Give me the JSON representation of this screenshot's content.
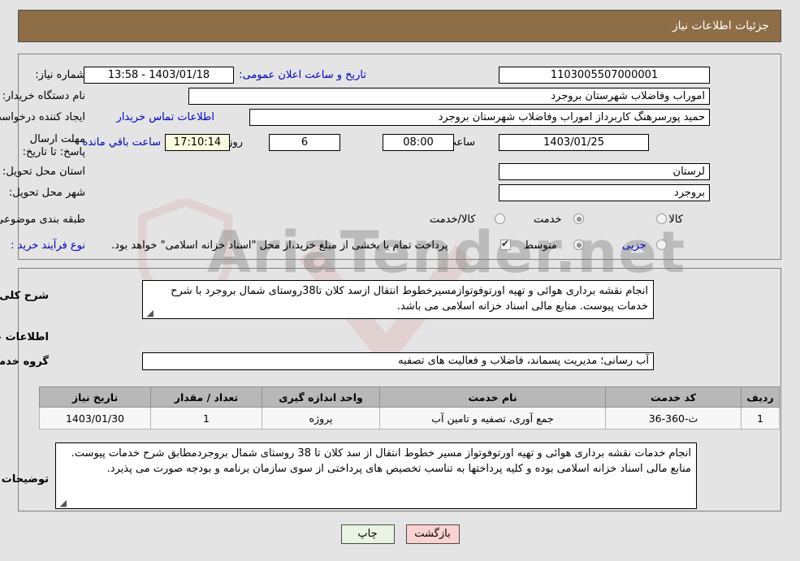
{
  "header": {
    "title": "جزئیات اطلاعات نیاز"
  },
  "form": {
    "need_number_label": "شماره نیاز:",
    "need_number_value": "1103005507000001",
    "announce_datetime_label": "تاریخ و ساعت اعلان عمومی:",
    "announce_datetime_value": "1403/01/18 - 13:58",
    "buyer_org_label": "نام دستگاه خریدار:",
    "buyer_org_value": "اموراب وفاضلاب شهرستان بروجرد",
    "requester_label": "ایجاد کننده درخواست:",
    "requester_value": "حمید پورسرهنگ کاربرداز اموراب وفاضلاب شهرستان بروجرد",
    "buyer_contact_link": "اطلاعات تماس خریدار",
    "deadline_label": "مهلت ارسال پاسخ: تا تاریخ:",
    "deadline_date": "1403/01/25",
    "deadline_time_label": "ساعت",
    "deadline_time": "08:00",
    "remaining_days": "6",
    "remaining_days_unit": "روز و",
    "remaining_clock": "17:10:14",
    "remaining_suffix": "ساعت باقي مانده",
    "province_label": "استان محل تحویل:",
    "province_value": "لرستان",
    "city_label": "شهر محل تحویل:",
    "city_value": "بروجرد",
    "category_label": "طبقه بندی موضوعی:",
    "category_options": [
      {
        "label": "کالا",
        "selected": false
      },
      {
        "label": "خدمت",
        "selected": true
      },
      {
        "label": "کالا/خدمت",
        "selected": false
      }
    ],
    "process_type_label": "نوع فرآیند خرید :",
    "process_type_options": [
      {
        "label": "جزیی",
        "selected": false
      },
      {
        "label": "متوسط",
        "selected": true
      }
    ],
    "treasury_checkbox_label": "پرداخت تمام یا بخشی از مبلغ خرید،از محل \"اسناد خزانه اسلامی\" خواهد بود.",
    "treasury_checkbox_checked": true
  },
  "description": {
    "label": "شرح کلی نیاز:",
    "value": "انجام نقشه برداری هوائی و تهیه اورتوفوتوازمسیرخطوط انتقال ازسد کلان تا38روستای شمال بروجرد با شرح خدمات پیوست. منابع مالی اسناد خزانه اسلامی می باشد."
  },
  "services": {
    "section_title": "اطلاعات خدمات مورد نیاز",
    "group_label": "گروه خدمت:",
    "group_value": "آب رسانی؛ مدیریت پسماند، فاضلاب و فعالیت های تصفیه",
    "table": {
      "columns": [
        "ردیف",
        "کد خدمت",
        "نام خدمت",
        "واحد اندازه گیری",
        "تعداد / مقدار",
        "تاریخ نیاز"
      ],
      "rows": [
        [
          "1",
          "ث-360-36",
          "جمع آوری، تصفیه و تامین آب",
          "پروژه",
          "1",
          "1403/01/30"
        ]
      ]
    }
  },
  "buyer_notes": {
    "label": "توضیحات خریدار:",
    "value": "انجام خدمات نقشه برداری هوائی و تهیه اورتوفوتواز مسیر خطوط انتقال از سد کلان تا 38 روستای شمال بروجردمطابق شرح خدمات پیوست. منابع مالی اسناد خزانه اسلامی بوده و کلیه پرداختها به تناسب تخصیص های پرداختی از سوی سازمان برنامه و بودجه صورت می پذیرد."
  },
  "footer": {
    "back_button": "بازگشت",
    "print_button": "چاپ"
  },
  "watermark": {
    "text": "AriaTender.net"
  },
  "colors": {
    "header_bg": "#8d6e46",
    "link": "#0000d0",
    "back_button_bg": "#fbd2d2",
    "print_button_bg": "#e8f5e2",
    "highlight_field_bg": "#fbfbe0",
    "table_header_bg": "#b8b8b8"
  }
}
